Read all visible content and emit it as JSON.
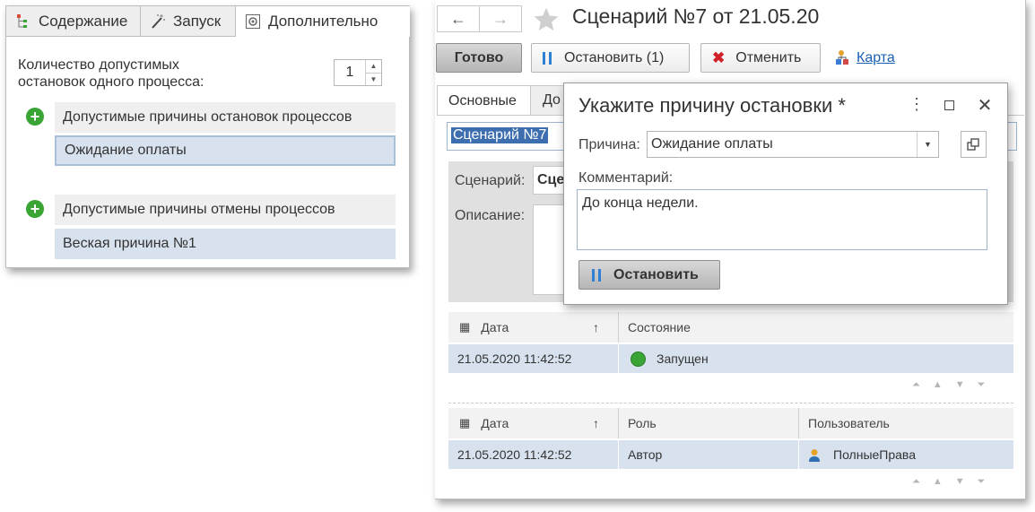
{
  "left_panel": {
    "tabs": [
      {
        "label": "Содержание",
        "icon": "tree-icon"
      },
      {
        "label": "Запуск",
        "icon": "wand-icon"
      },
      {
        "label": "Дополнительно",
        "icon": "gear-icon"
      }
    ],
    "max_stops_label": "Количество допустимых\nостановок одного процесса:",
    "max_stops_value": "1",
    "stop_reasons_header": "Допустимые причины остановок процессов",
    "stop_reasons": [
      "Ожидание оплаты"
    ],
    "cancel_reasons_header": "Допустимые причины отмены процессов",
    "cancel_reasons": [
      "Веская причина №1"
    ]
  },
  "main_window": {
    "nav_back": "←",
    "nav_forward": "→",
    "title": "Сценарий №7 от 21.05.20",
    "toolbar": {
      "ready_label": "Готово",
      "stop_label": "Остановить (1)",
      "cancel_label": "Отменить",
      "map_label": "Карта"
    },
    "tabs": [
      "Основные",
      "До"
    ],
    "name_field_value": "Сценарий №7",
    "scenario_label": "Сценарий:",
    "scenario_value": "Сце",
    "description_label": "Описание:",
    "states_table": {
      "columns": [
        "Дата",
        "Состояние"
      ],
      "sort_indicator": "↑",
      "rows": [
        {
          "date": "21.05.2020 11:42:52",
          "state": "Запущен"
        }
      ]
    },
    "roles_table": {
      "columns": [
        "Дата",
        "Роль",
        "Пользователь"
      ],
      "sort_indicator": "↑",
      "rows": [
        {
          "date": "21.05.2020 11:42:52",
          "role": "Автор",
          "user": "ПолныеПрава"
        }
      ]
    }
  },
  "dialog": {
    "title": "Укажите причину остановки *",
    "reason_label": "Причина:",
    "reason_value": "Ожидание оплаты",
    "comment_label": "Комментарий:",
    "comment_value": "До конца недели.",
    "stop_button_label": "Остановить"
  },
  "colors": {
    "selection": "#d7e2ee",
    "link": "#1a5fb4",
    "status_green": "#3aa435",
    "cancel_red": "#d0202a",
    "pause_blue": "#2f7fd3"
  }
}
